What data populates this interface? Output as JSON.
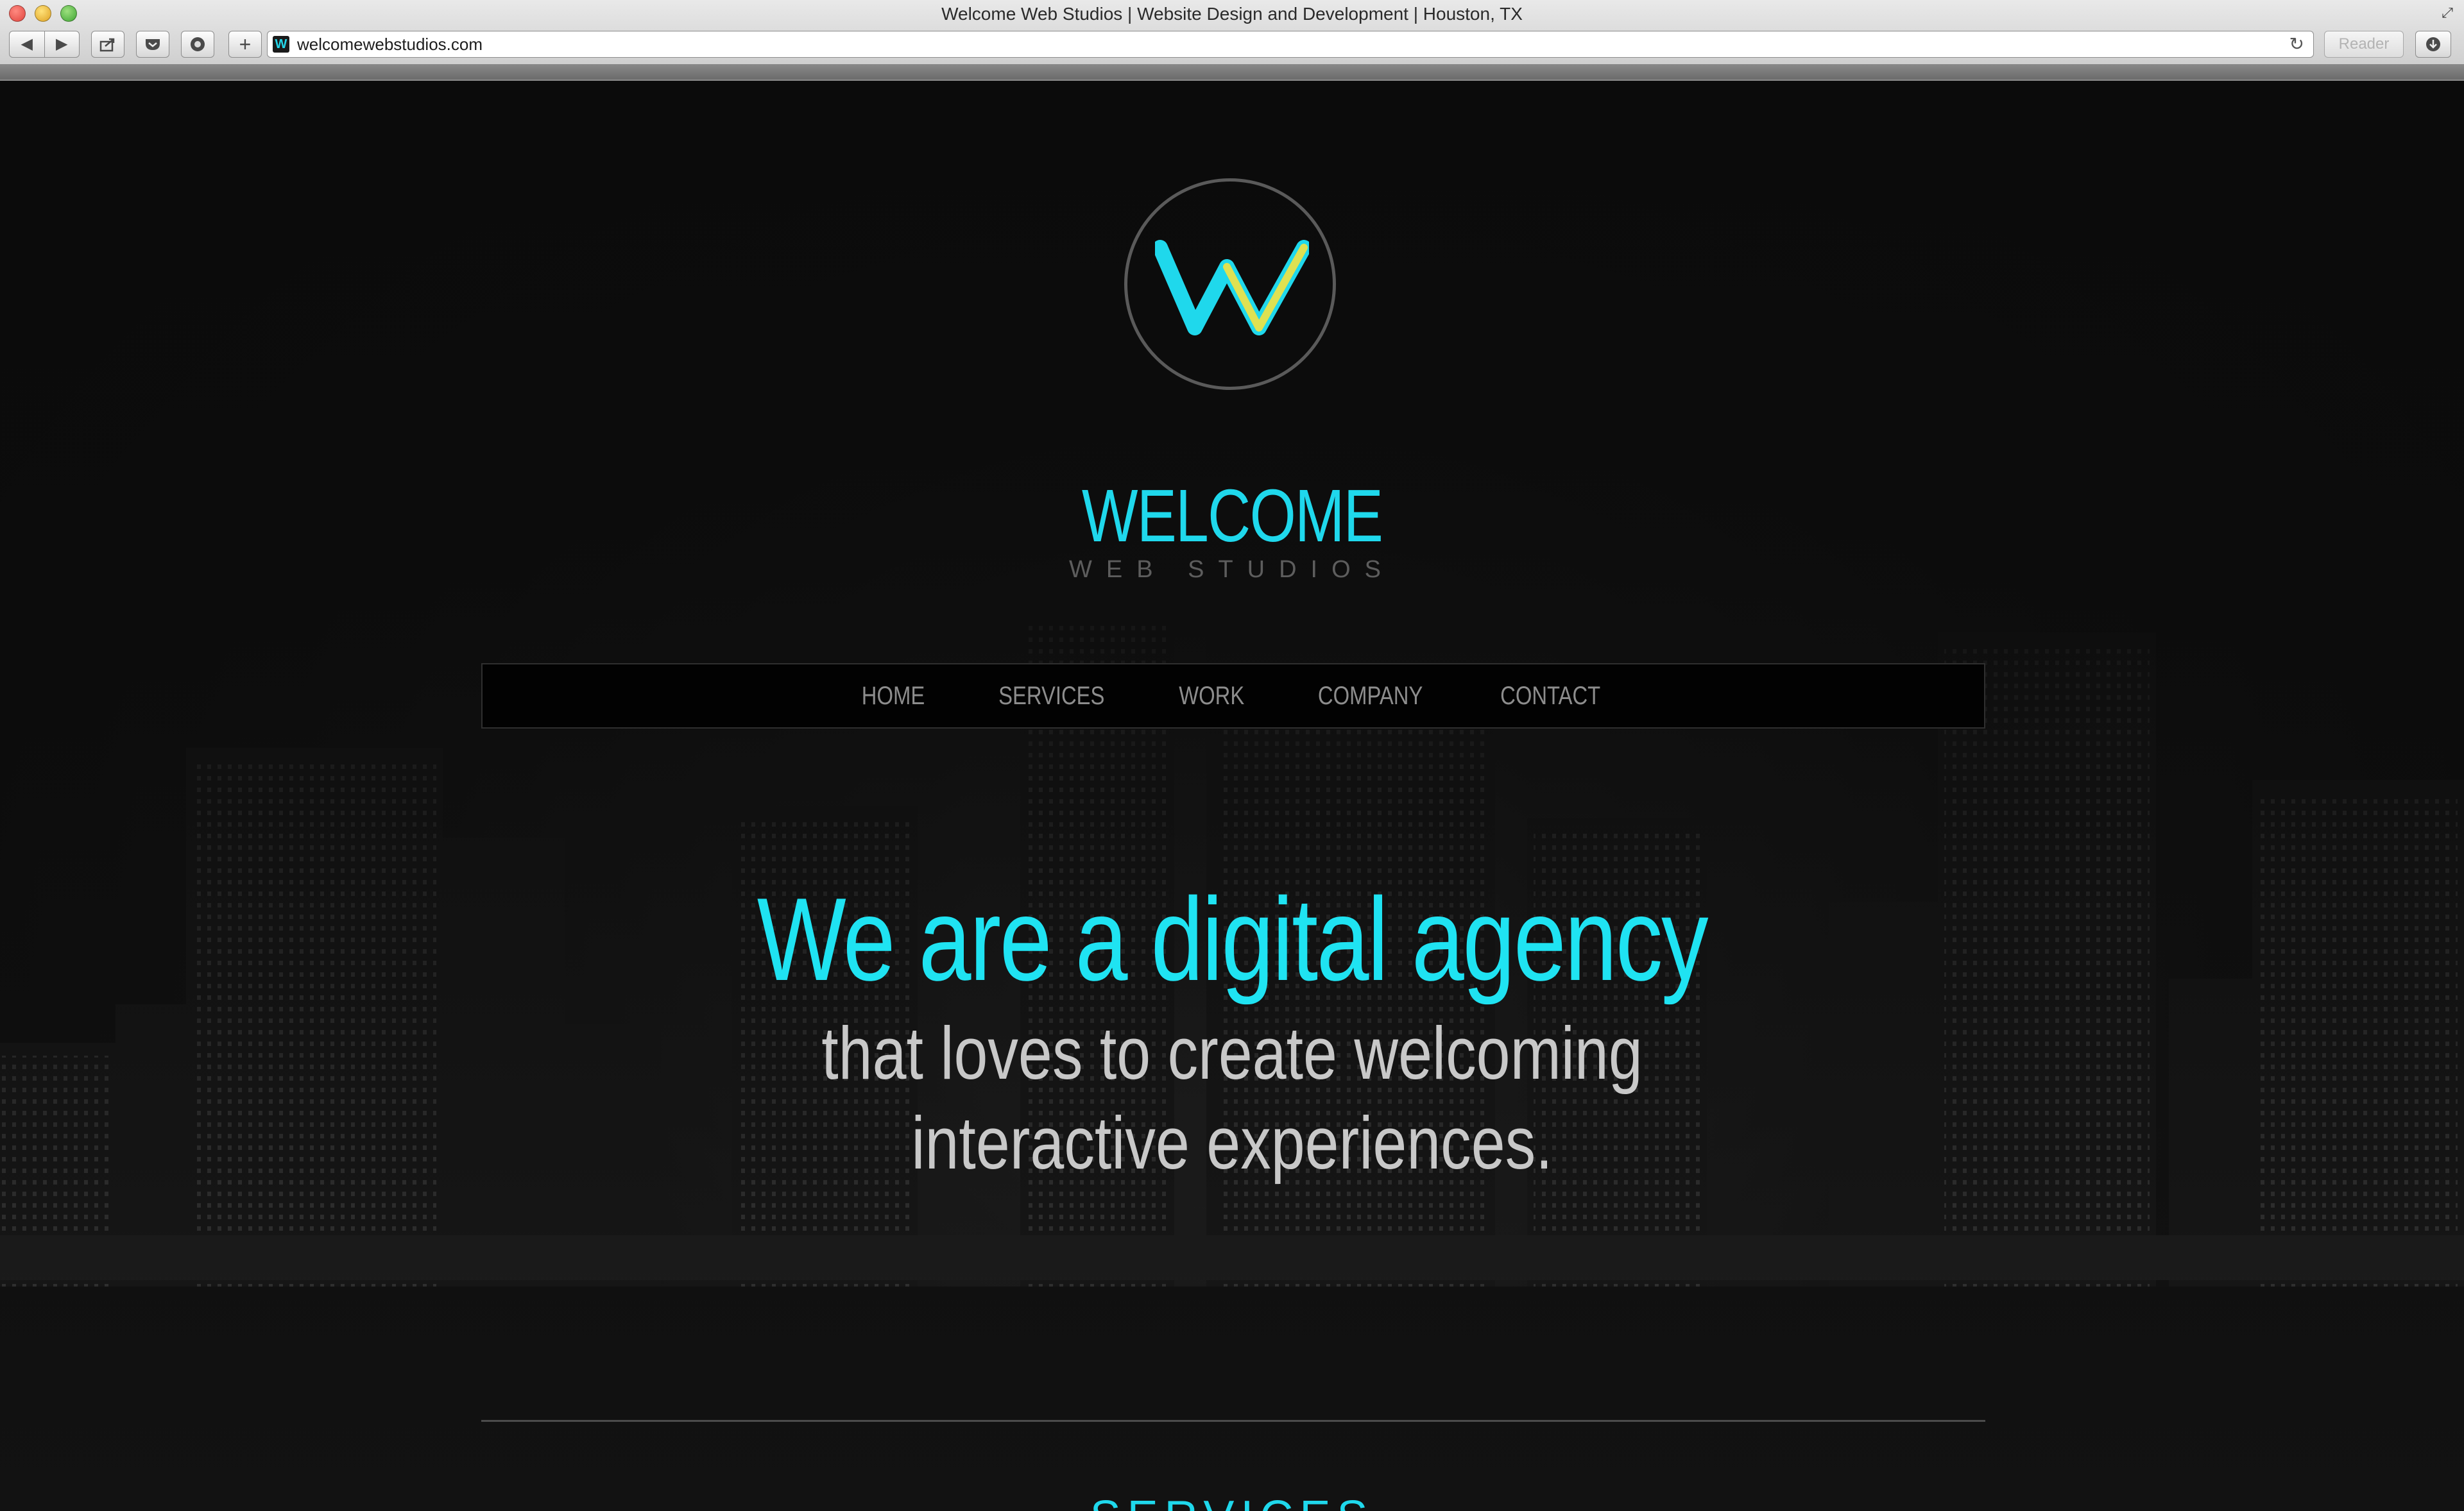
{
  "browser": {
    "window_title": "Welcome Web Studios | Website Design and Development | Houston, TX",
    "url": "welcomewebstudios.com",
    "reader_label": "Reader",
    "icons": {
      "back": "back-arrow-icon",
      "forward": "forward-arrow-icon",
      "share": "share-icon",
      "pocket": "pocket-icon",
      "readlater": "read-later-icon",
      "newtab": "plus-icon",
      "reload": "reload-icon",
      "download": "download-icon",
      "resize": "fullscreen-icon"
    }
  },
  "brand": {
    "name": "WELCOME",
    "subtitle": "WEB STUDIOS",
    "accent_color": "#1fd8ec",
    "secondary_color": "#e9e24a"
  },
  "nav": {
    "items": [
      {
        "label": "HOME"
      },
      {
        "label": "SERVICES"
      },
      {
        "label": "WORK"
      },
      {
        "label": "COMPANY"
      },
      {
        "label": "CONTACT"
      }
    ]
  },
  "hero": {
    "title": "We are a digital agency",
    "line1": "that loves to create welcoming",
    "line2": "interactive experiences."
  },
  "next_section": {
    "heading": "SERVICES"
  }
}
